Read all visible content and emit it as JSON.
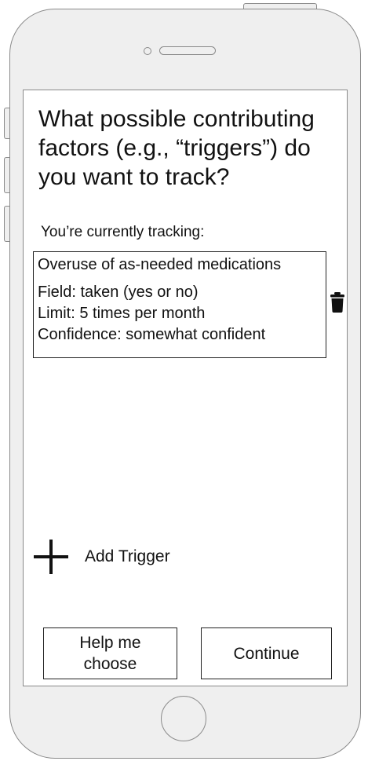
{
  "question": {
    "text": "What possible contributing factors (e.g., “triggers”) do you want to track?"
  },
  "tracking": {
    "label": "You’re currently tracking:",
    "items": [
      {
        "title": "Overuse of as-needed medications",
        "field": "Field: taken (yes or no)",
        "limit": "Limit: 5 times per month",
        "confidence": "Confidence: somewhat confident",
        "delete_icon": "trash-icon"
      }
    ]
  },
  "add_trigger": {
    "label": "Add Trigger",
    "icon": "plus-icon"
  },
  "footer": {
    "help_label": "Help me choose",
    "continue_label": "Continue"
  },
  "colors": {
    "frame": "#efefef",
    "frame_border": "#8a8a8a",
    "screen": "#ffffff",
    "text": "#111111"
  }
}
